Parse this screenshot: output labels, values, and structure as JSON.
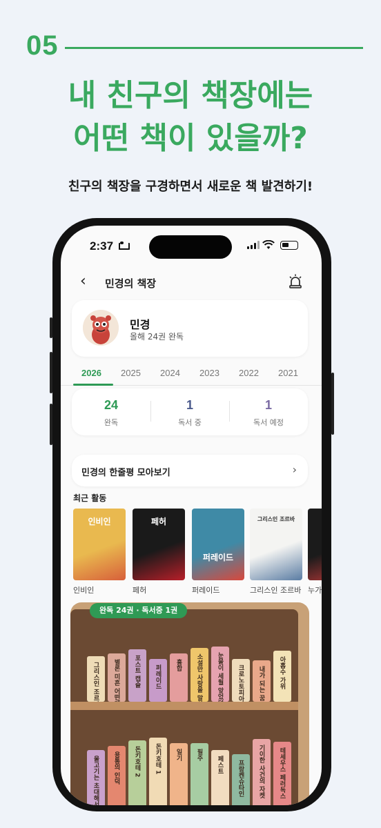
{
  "hero": {
    "step": "05",
    "headline_line1": "내 친구의 책장에는",
    "headline_line2": "어떤 책이 있을까?",
    "subtitle": "친구의 책장을 구경하면서 새로운 책 발견하기!"
  },
  "status_bar": {
    "time": "2:37"
  },
  "nav": {
    "back_icon": "chevron-left-icon",
    "title": "민경의 책장",
    "alarm_icon": "siren-icon"
  },
  "profile": {
    "name": "민경",
    "summary": "올해 24권 완독"
  },
  "year_tabs": [
    "2026",
    "2025",
    "2024",
    "2023",
    "2022",
    "2021"
  ],
  "selected_year": "2026",
  "stats": [
    {
      "value": "24",
      "label": "완독",
      "color": "#2e9a55"
    },
    {
      "value": "1",
      "label": "독서 중",
      "color": "#4b5a8c"
    },
    {
      "value": "1",
      "label": "독서 예정",
      "color": "#7a6aa3"
    }
  ],
  "reviews_link": {
    "label": "민경의 한줄평 모아보기"
  },
  "recent": {
    "title": "최근 활동",
    "books": [
      {
        "label": "인비인",
        "cover_title": "인비인",
        "colors": [
          "#e9b94f",
          "#d75f3a"
        ]
      },
      {
        "label": "페허",
        "cover_title": "페허",
        "colors": [
          "#1a1a1a",
          "#b81f29"
        ]
      },
      {
        "label": "퍼레이드",
        "cover_title": "퍼레이드",
        "colors": [
          "#3f8aa6",
          "#d9483c"
        ]
      },
      {
        "label": "그리스인 조르바",
        "cover_title": "그리스인 조르바",
        "colors": [
          "#f4f4f2",
          "#5a7ca3"
        ]
      },
      {
        "label": "누가",
        "cover_title": "",
        "colors": [
          "#1b1b1b",
          "#c53a3a"
        ]
      }
    ]
  },
  "shelf": {
    "badge": "완독 24권 · 독서중 1권",
    "row1": [
      {
        "title": "그리스인 조르바",
        "color": "#eedcb7"
      },
      {
        "title": "별론 미흔 어떤데",
        "color": "#dca99a"
      },
      {
        "title": "포스트 캡슐",
        "color": "#c8a2c8"
      },
      {
        "title": "퍼레이드",
        "color": "#c79bc9"
      },
      {
        "title": "흉합",
        "color": "#e49d9d"
      },
      {
        "title": "소설만 사랑을 말하였다",
        "color": "#efc66b"
      },
      {
        "title": "눈물이 세월 앞었던다",
        "color": "#e6a3b0"
      },
      {
        "title": "크로노토피아: 엘리...",
        "color": "#efdcbc"
      },
      {
        "title": "내가 되는 꿈",
        "color": "#e9a88a"
      },
      {
        "title": "아홉수 가위",
        "color": "#f3e3b7"
      }
    ],
    "row2": [
      {
        "title": "울고기는 초대해서",
        "color": "#c9a1cc"
      },
      {
        "title": "용통의 인덕",
        "color": "#e4876f"
      },
      {
        "title": "돈키호테 2",
        "color": "#b7cf9a"
      },
      {
        "title": "돈키호테 1",
        "color": "#f1dbb5"
      },
      {
        "title": "일기",
        "color": "#f0b48a"
      },
      {
        "title": "필주",
        "color": "#a7cda3"
      },
      {
        "title": "페스트",
        "color": "#f2dcc0"
      },
      {
        "title": "프랑켄슈타인",
        "color": "#8fb9a0"
      },
      {
        "title": "기이한 사건의 자켓",
        "color": "#e8a5a5"
      },
      {
        "title": "테세우스 페러독스",
        "color": "#e68888"
      }
    ]
  }
}
